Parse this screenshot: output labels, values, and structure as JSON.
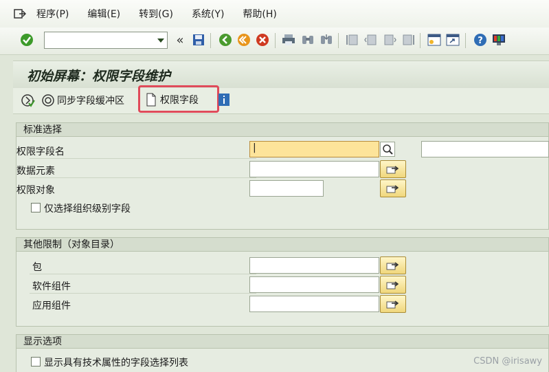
{
  "menu": {
    "items": [
      "程序(P)",
      "编辑(E)",
      "转到(G)",
      "系统(Y)",
      "帮助(H)"
    ]
  },
  "toolbar": {
    "command_value": "",
    "back_label": "«"
  },
  "title": "初始屏幕：权限字段维护",
  "appbar": {
    "sync_label": "同步字段缓冲区",
    "auth_field_label": "权限字段"
  },
  "group_standard": {
    "title": "标准选择",
    "field_auth_name": "权限字段名",
    "field_data_element": "数据元素",
    "field_auth_object": "权限对象",
    "checkbox_org_level": "仅选择组织级别字段",
    "auth_name_value": "|"
  },
  "group_other": {
    "title": "其他限制（对象目录）",
    "field_package": "包",
    "field_software_component": "软件组件",
    "field_application_component": "应用组件"
  },
  "group_display": {
    "title": "显示选项",
    "checkbox_tech_attrs": "显示具有技术属性的字段选择列表"
  },
  "watermark": "CSDN @irisawy"
}
